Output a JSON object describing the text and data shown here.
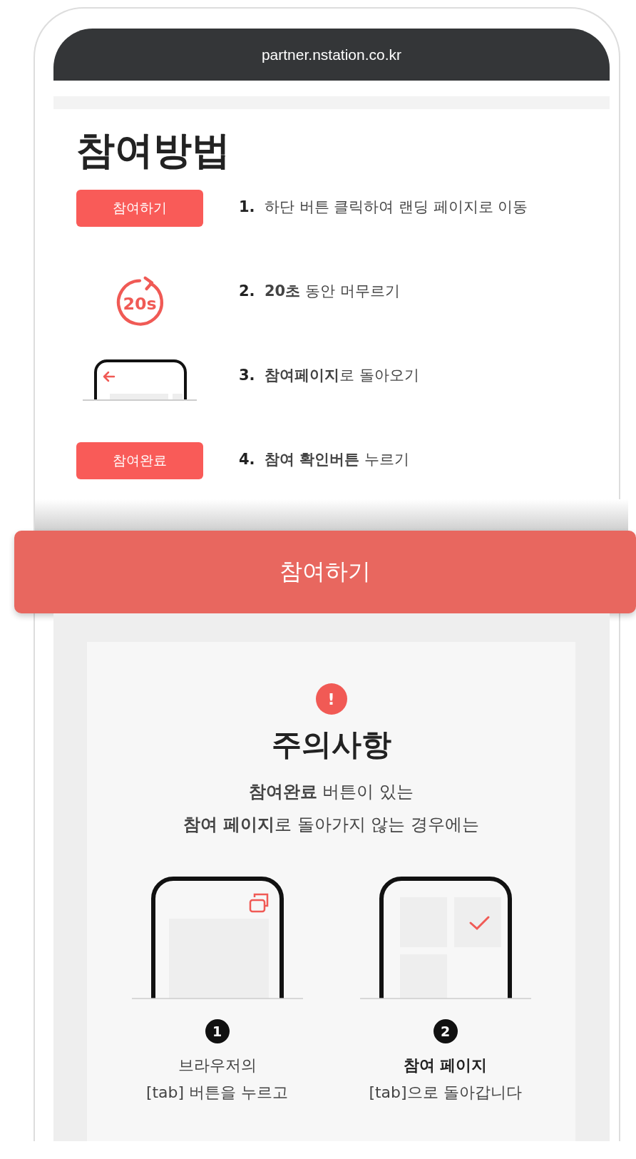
{
  "browser": {
    "url": "partner.nstation.co.kr"
  },
  "guide": {
    "title": "참여방법",
    "steps": [
      {
        "kind": "button",
        "badge": "참여하기",
        "number": "1.",
        "text": "하단 버튼 클릭하여 랜딩 페이지로 이동"
      },
      {
        "kind": "timer",
        "timer_label": "20s",
        "number": "2.",
        "text": "**20초** 동안 머무르기"
      },
      {
        "kind": "phone",
        "number": "3.",
        "text": "**참여페이지**로 돌아오기"
      },
      {
        "kind": "button",
        "badge": "참여완료",
        "number": "4.",
        "text": "**참여 확인버튼** 누르기"
      }
    ]
  },
  "cta": {
    "label": "참여하기"
  },
  "notice": {
    "icon_label": "!",
    "title": "주의사항",
    "lines": [
      "**참여완료** 버튼이 있는",
      "**참여 페이지**로 돌아가지 않는 경우에는"
    ],
    "tips": [
      {
        "kind": "tabs",
        "number": "1",
        "lines": [
          "브라우저의",
          "[tab] 버튼을 누르고"
        ]
      },
      {
        "kind": "grid",
        "number": "2",
        "title": "참여 페이지",
        "lines": [
          "[tab]으로 돌아갑니다"
        ]
      }
    ]
  }
}
